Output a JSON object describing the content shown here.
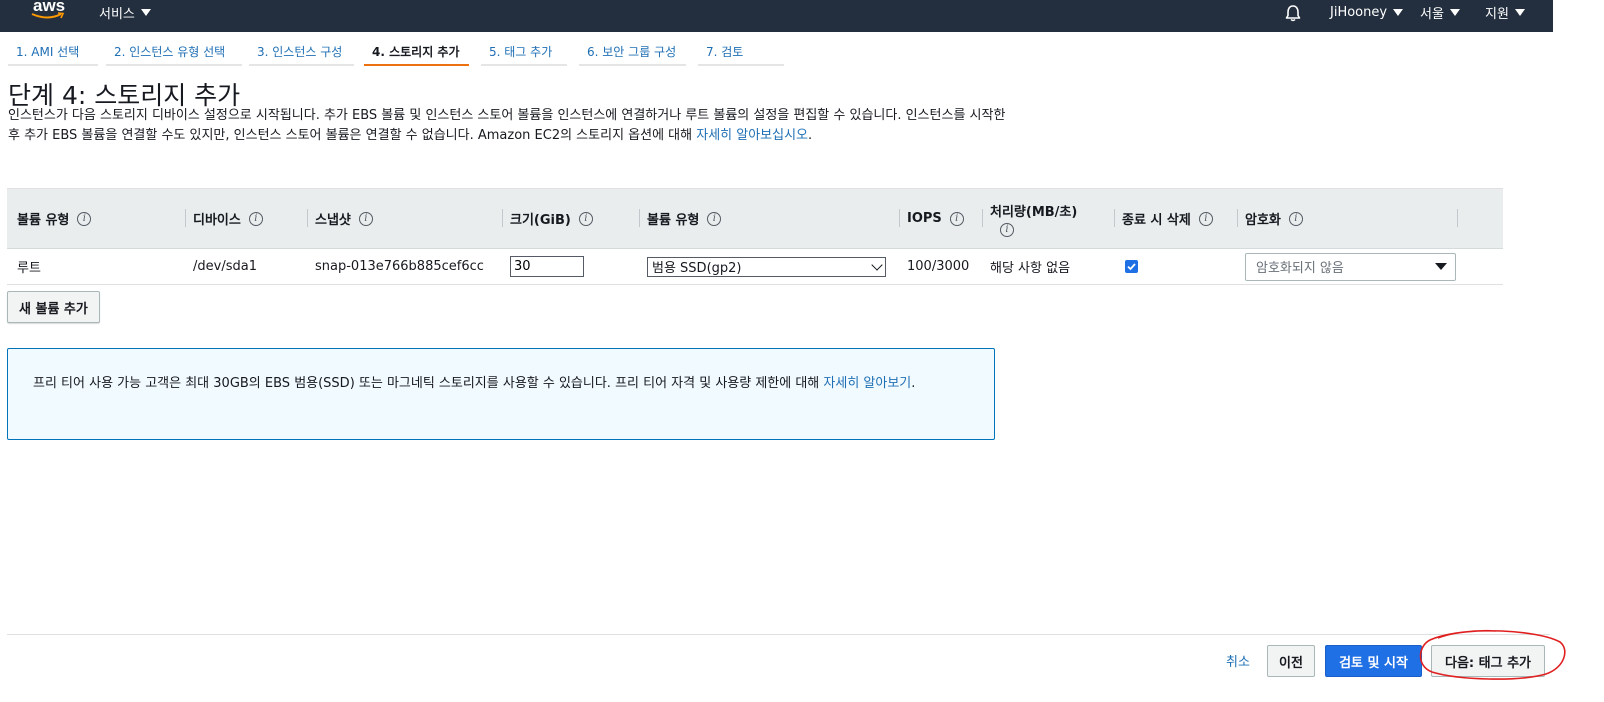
{
  "topnav": {
    "logo_text": "aws",
    "services_label": "서비스",
    "user_label": "JiHooney",
    "region_label": "서울",
    "support_label": "지원"
  },
  "tabs": [
    {
      "label": "1. AMI 선택",
      "active": false
    },
    {
      "label": "2. 인스턴스 유형 선택",
      "active": false
    },
    {
      "label": "3. 인스턴스 구성",
      "active": false
    },
    {
      "label": "4. 스토리지 추가",
      "active": true
    },
    {
      "label": "5. 태그 추가",
      "active": false
    },
    {
      "label": "6. 보안 그룹 구성",
      "active": false
    },
    {
      "label": "7. 검토",
      "active": false
    }
  ],
  "page": {
    "title": "단계 4: 스토리지 추가",
    "description": "인스턴스가 다음 스토리지 디바이스 설정으로 시작됩니다. 추가 EBS 볼륨 및 인스턴스 스토어 볼륨을 인스턴스에 연결하거나 루트 볼륨의 설정을 편집할 수 있습니다. 인스턴스를 시작한 후 추가 EBS 볼륨을 연결할 수도 있지만, 인스턴스 스토어 볼륨은 연결할 수 없습니다. Amazon EC2의 스토리지 옵션에 대해 ",
    "description_link": "자세히 알아보십시오",
    "description_end": "."
  },
  "table": {
    "headers": {
      "volume_type": "볼륨 유형",
      "device": "디바이스",
      "snapshot": "스냅샷",
      "size": "크기(GiB)",
      "volume_kind": "볼륨 유형",
      "iops": "IOPS",
      "throughput": "처리량(MB/초)",
      "delete_on_term": "종료 시 삭제",
      "encryption": "암호화"
    },
    "row": {
      "volume_type": "루트",
      "device": "/dev/sda1",
      "snapshot": "snap-013e766b885cef6cc",
      "size": "30",
      "volume_kind": "범용 SSD(gp2)",
      "iops": "100/3000",
      "throughput": "해당 사항 없음",
      "delete_on_term": true,
      "encryption": "암호화되지 않음"
    },
    "info_glyph": "i"
  },
  "add_volume_label": "새 볼륨 추가",
  "notice": {
    "text": "프리 티어 사용 가능 고객은 최대 30GB의 EBS 범용(SSD) 또는 마그네틱 스토리지를 사용할 수 있습니다. 프리 티어 자격 및 사용량 제한에 대해 ",
    "link": "자세히 알아보기",
    "end": "."
  },
  "footer": {
    "cancel": "취소",
    "previous": "이전",
    "review_launch": "검토 및 시작",
    "next": "다음: 태그 추가"
  },
  "colors": {
    "nav_bg": "#232f3e",
    "link": "#1f6fb5",
    "primary": "#1f6fe5",
    "active_tab": "#ec7211",
    "annotation": "#e02020"
  }
}
